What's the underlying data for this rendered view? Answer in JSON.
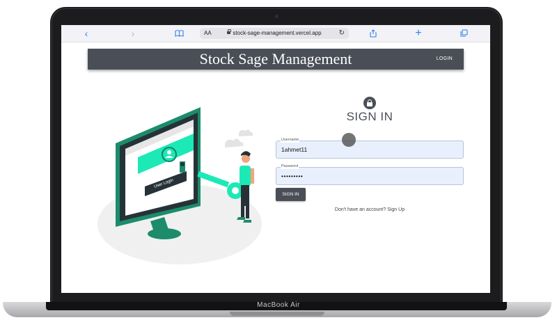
{
  "device": {
    "model_label": "MacBook Air"
  },
  "browser": {
    "text_size_label": "AA",
    "url": "stock-sage-management.vercel.app",
    "icons": [
      "back-icon",
      "forward-icon",
      "bookmarks-icon",
      "lock-icon",
      "reload-icon",
      "share-icon",
      "new-tab-icon",
      "tabs-icon"
    ]
  },
  "header": {
    "title": "Stock Sage Management",
    "login_link": "LOGIN"
  },
  "illustration": {
    "screen_caption": "User Login"
  },
  "signin": {
    "heading": "SIGN IN",
    "username_label": "Username",
    "username_value": "1ahmet11",
    "password_label": "Password",
    "password_value": "•••••••••",
    "submit_label": "SIGN IN",
    "signup_text": "Don't have an account? Sign Up"
  },
  "colors": {
    "header_bg": "#4a4e57",
    "accent": "#1de9b6",
    "input_bg": "#e8f0fe",
    "browser_icon": "#2f80ed"
  }
}
